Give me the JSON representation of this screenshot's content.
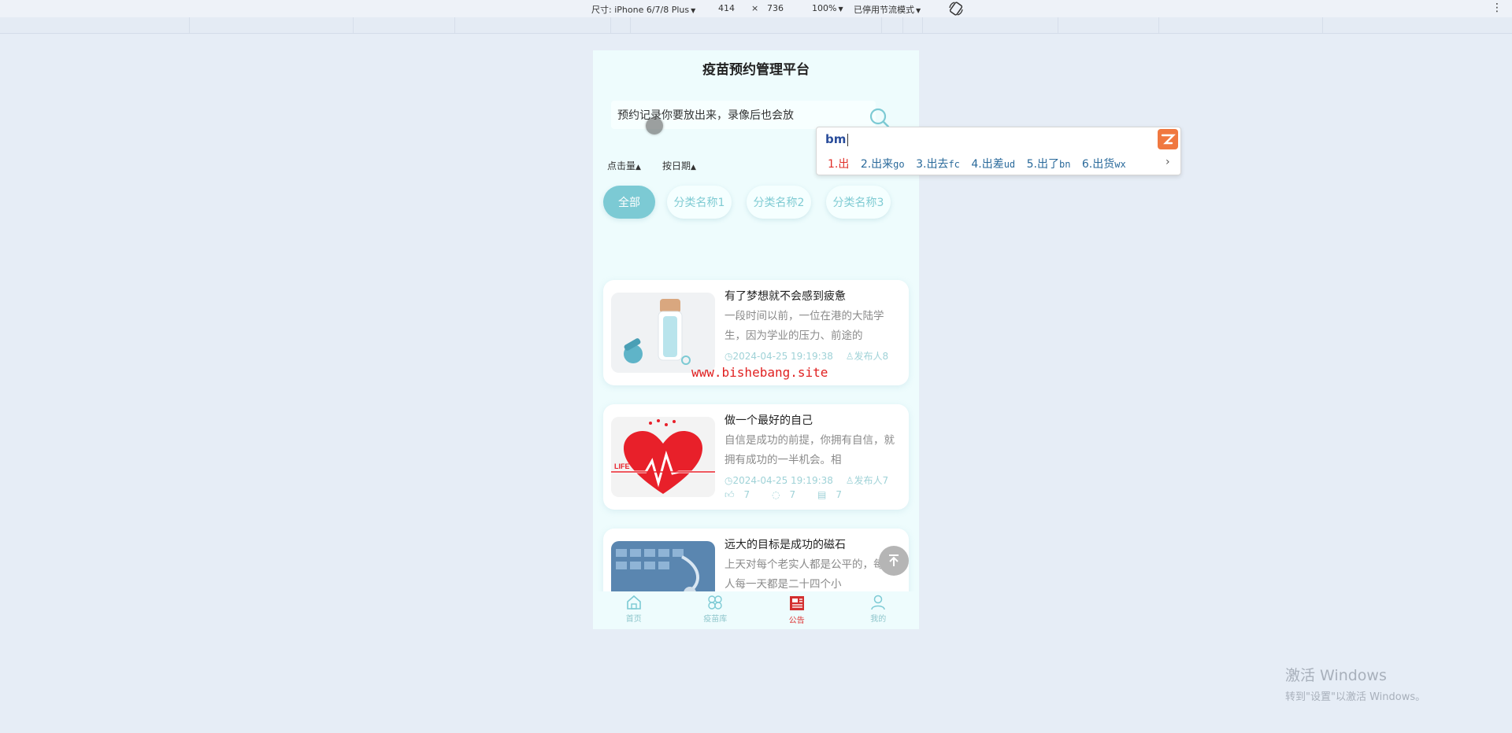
{
  "devtools": {
    "device_label": "尺寸: iPhone 6/7/8 Plus",
    "width": "414",
    "times": "×",
    "height": "736",
    "zoom": "100%",
    "throttle": "已停用节流模式",
    "icons": [
      "chevron-down-icon",
      "rotate-icon",
      "kebab-menu-icon"
    ]
  },
  "app": {
    "title": "疫苗预约管理平台",
    "search": {
      "value": "预约记录你要放出来，录像后也会放",
      "icon": "search-icon"
    },
    "sort": [
      {
        "label": "点击量",
        "icon": "triangle-up-icon"
      },
      {
        "label": "按日期",
        "icon": "triangle-up-icon"
      }
    ],
    "categories": [
      "全部",
      "分类名称1",
      "分类名称2",
      "分类名称3"
    ],
    "active_category": "全部",
    "articles": [
      {
        "title": "有了梦想就不会感到疲惫",
        "desc": "一段时间以前，一位在港的大陆学生，因为学业的压力、前途的",
        "date": "2024-04-25 19:19:38",
        "author": "发布人8",
        "likes": "",
        "comments": "",
        "views": "",
        "image": "doctor-with-microscope"
      },
      {
        "title": "做一个最好的自己",
        "desc": "自信是成功的前提，你拥有自信，就拥有成功的一半机会。相",
        "date": "2024-04-25 19:19:38",
        "author": "发布人7",
        "likes": "7",
        "comments": "7",
        "views": "7",
        "image": "heart-life"
      },
      {
        "title": "远大的目标是成功的磁石",
        "desc": "上天对每个老实人都是公平的，每个人每一天都是二十四个小",
        "date": "",
        "author": "",
        "likes": "",
        "comments": "",
        "views": "",
        "image": "stethoscope-keyboard"
      }
    ],
    "watermark": "www.bishebang.site",
    "back_to_top_icon": "arrow-up-icon",
    "tabbar": [
      {
        "label": "首页",
        "icon": "home-icon"
      },
      {
        "label": "疫苗库",
        "icon": "clover-icon"
      },
      {
        "label": "公告",
        "icon": "newspaper-icon"
      },
      {
        "label": "我的",
        "icon": "user-icon"
      }
    ],
    "active_tab": "公告"
  },
  "ime": {
    "pinyin": "bm",
    "candidates": [
      {
        "index": "1.",
        "text": "出",
        "code": ""
      },
      {
        "index": "2.",
        "text": "出来",
        "code": "go"
      },
      {
        "index": "3.",
        "text": "出去",
        "code": "fc"
      },
      {
        "index": "4.",
        "text": "出差",
        "code": "ud"
      },
      {
        "index": "5.",
        "text": "出了",
        "code": "bn"
      },
      {
        "index": "6.",
        "text": "出货",
        "code": "wx"
      }
    ],
    "next_icon": "chevron-right-icon",
    "logo_icon": "ime-logo-icon"
  },
  "os": {
    "activate_title": "激活 Windows",
    "activate_hint": "转到\"设置\"以激活 Windows。"
  },
  "colors": {
    "accent": "#7ccad4",
    "page_bg": "#eefcfd",
    "active_tab": "#dd3333",
    "watermark": "#e02020"
  }
}
